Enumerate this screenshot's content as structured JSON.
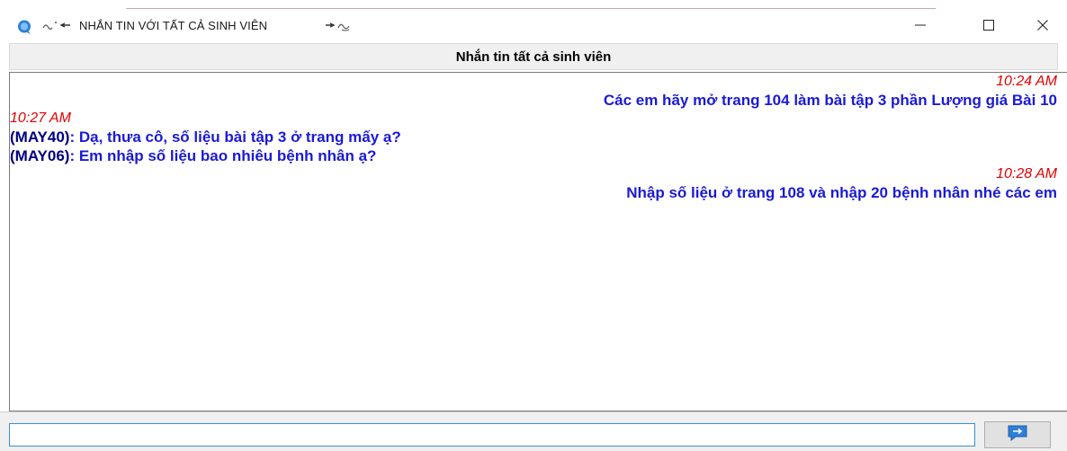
{
  "window": {
    "title": "NHẮN TIN VỚI TẤT CẢ SINH VIÊN",
    "title_deco_left": "ى",
    "title_deco_right": "»ﺳ",
    "accent_color": "#1a1ad6",
    "timestamp_color": "#e00000"
  },
  "header": {
    "title": "Nhắn tin tất cả sinh viên"
  },
  "chat": {
    "messages": [
      {
        "align": "right",
        "time": "10:24 AM",
        "lines": [
          {
            "sender": "",
            "text": "Các em hãy mở trang 104 làm bài tập 3 phần Lượng giá Bài 10"
          }
        ]
      },
      {
        "align": "left",
        "time": "10:27 AM",
        "lines": [
          {
            "sender": "(MAY40)",
            "text": ": Dạ, thưa cô, số liệu bài tập 3 ở trang mấy ạ?"
          },
          {
            "sender": "(MAY06)",
            "text": ": Em nhập số liệu bao nhiêu bệnh nhân ạ?"
          }
        ]
      },
      {
        "align": "right",
        "time": "10:28 AM",
        "lines": [
          {
            "sender": "",
            "text": "Nhập số liệu ở trang 108 và nhập 20 bệnh nhân nhé các em"
          }
        ]
      }
    ]
  },
  "input": {
    "value": "",
    "placeholder": ""
  },
  "icons": {
    "app": "chat-bubble-icon",
    "minimize": "minimize-icon",
    "maximize": "maximize-icon",
    "close": "close-icon",
    "send": "send-arrow-icon"
  }
}
